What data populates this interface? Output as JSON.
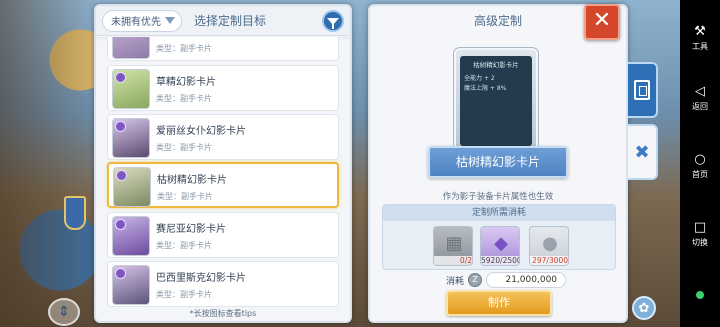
{
  "list_panel": {
    "filter_select_value": "未拥有优先",
    "title": "选择定制目标",
    "hint": "*长按图标查看tips",
    "items": [
      {
        "name": "",
        "type": "类型：副手卡片"
      },
      {
        "name": "草精幻影卡片",
        "type": "类型：副手卡片"
      },
      {
        "name": "爱丽丝女仆幻影卡片",
        "type": "类型：副手卡片"
      },
      {
        "name": "枯树精幻影卡片",
        "type": "类型：副手卡片",
        "selected": true
      },
      {
        "name": "赛尼亚幻影卡片",
        "type": "类型：副手卡片"
      },
      {
        "name": "巴西里斯克幻影卡片",
        "type": "类型：副手卡片"
      }
    ]
  },
  "detail_panel": {
    "title": "高级定制",
    "close_glyph": "✕",
    "card_preview": {
      "name": "枯树精幻影卡片",
      "stats": [
        "全能力 + 2",
        "魔法上限 + 8%"
      ]
    },
    "ribbon_label": "枯树精幻影卡片",
    "effect_note": "作为影子装备卡片属性也生效",
    "cost_title": "定制所需消耗",
    "materials": [
      {
        "icon": "card-shard-icon",
        "have": "0",
        "need": "2",
        "count_text": "0/2"
      },
      {
        "icon": "purple-crystal-icon",
        "have": "5920",
        "need": "2500",
        "count_text": "5920/2500"
      },
      {
        "icon": "silver-powder-icon",
        "have": "297",
        "need": "3000",
        "count_text": "297/3000"
      }
    ],
    "consume_label": "消耗",
    "consume_value": "21,000,000",
    "make_button": "制作"
  },
  "system_bar": {
    "items": [
      {
        "glyph": "⚒",
        "label": "工具"
      },
      {
        "glyph": "◁",
        "label": "返回"
      },
      {
        "glyph": "○",
        "label": "首页"
      },
      {
        "glyph": "□",
        "label": "切换"
      }
    ]
  },
  "colors": {
    "accent_blue": "#2f6fb6",
    "selected_border": "#f0b93b",
    "close_red": "#d4472a",
    "make_orange": "#e39a1d",
    "low_count_red": "#d13c2c"
  }
}
